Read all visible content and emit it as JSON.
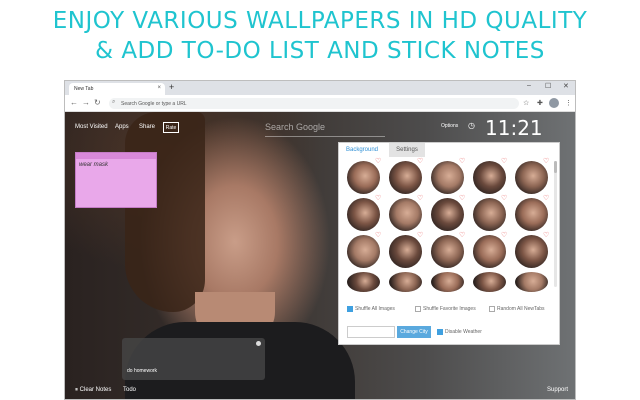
{
  "headline": {
    "line1": "ENJOY VARIOUS WALLPAPERS IN HD QUALITY",
    "line2": "& ADD TO-DO LIST AND STICK NOTES"
  },
  "browser": {
    "tab_title": "New Tab",
    "tab_close": "×",
    "new_tab": "+",
    "window_controls": [
      "–",
      "☐",
      "✕"
    ],
    "nav": [
      "←",
      "→",
      "↻"
    ],
    "omnibox_placeholder": "Search Google or type a URL",
    "toolbar_icons": [
      "star-icon",
      "puzzle-icon",
      "avatar",
      "menu-icon"
    ],
    "star": "☆",
    "puzzle": "✚",
    "menu": "⋮"
  },
  "newtab": {
    "nav": [
      "Most Visited",
      "Apps",
      "Share"
    ],
    "rate": "Rate",
    "search_placeholder": "Search Google",
    "options": "Options",
    "clock": "11:21"
  },
  "sticky_note": {
    "text": "wear mask",
    "color": "#e9a8ea"
  },
  "todo": {
    "text": "do homework"
  },
  "panel": {
    "tabs": [
      "Background",
      "Settings"
    ],
    "active_tab": "Background",
    "checkboxes": [
      {
        "label": "Shuffle All Images",
        "checked": true
      },
      {
        "label": "Shuffle Favorite Images",
        "checked": false
      },
      {
        "label": "Random All NewTabs",
        "checked": false
      }
    ],
    "city_placeholder": "",
    "change_city": "Change City",
    "disable_weather": {
      "label": "Disable Weather",
      "checked": true
    },
    "accent": "#2d8fd5"
  },
  "bottom": {
    "clear_notes": "⏸ Clear Notes",
    "todo": "Todo",
    "support": "Support"
  },
  "colors": {
    "headline": "#1fc4cf",
    "heart": "#e85a5a",
    "button": "#5aa9de"
  }
}
